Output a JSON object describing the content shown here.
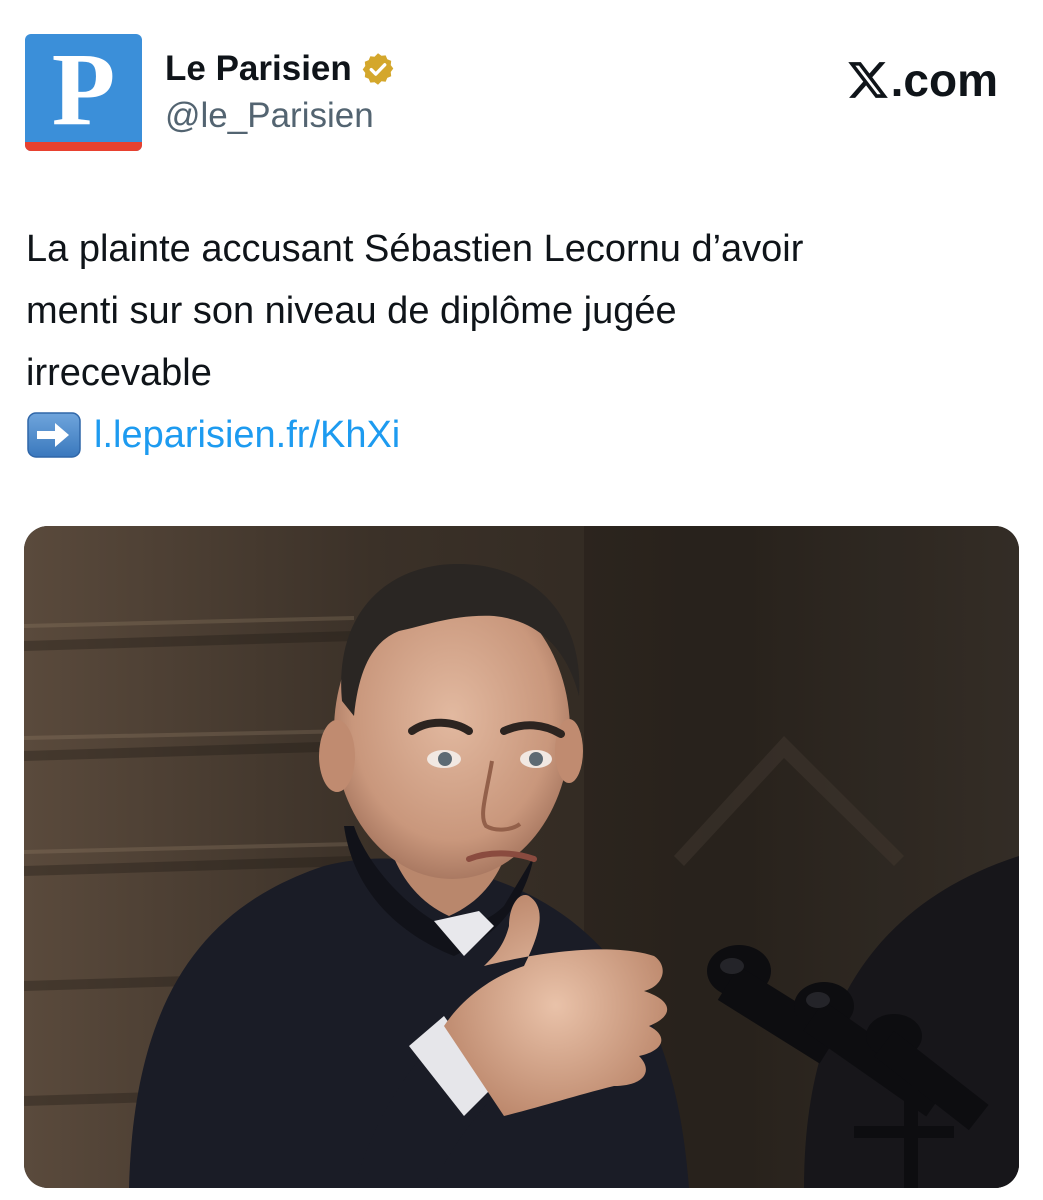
{
  "account": {
    "avatar_letter": "P",
    "display_name": "Le Parisien",
    "handle": "@le_Parisien",
    "verified_badge": "gold-check-icon",
    "avatar_bg": "#3b8fd9",
    "avatar_stripe": "#e8412f"
  },
  "brand": {
    "logo_icon": "x-logo-icon",
    "suffix": ".com"
  },
  "tweet": {
    "lines": [
      "La plainte accusant Sébastien Lecornu d’avoir",
      "menti sur son niveau de diplôme jugée",
      "irrecevable"
    ],
    "arrow_emoji": "right-arrow-emoji-icon",
    "link": "l.leparisien.fr/KhXi",
    "link_color": "#1d9bf0"
  },
  "media": {
    "type": "photo",
    "icon": "news-photo"
  }
}
